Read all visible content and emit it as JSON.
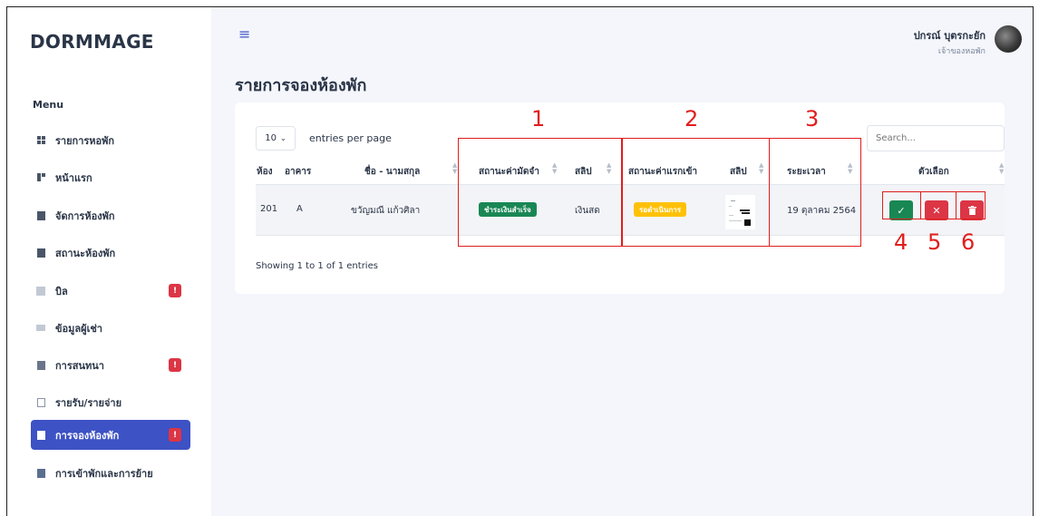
{
  "brand": "DORMMAGE",
  "sidebar": {
    "menu_title": "Menu",
    "items": [
      {
        "label": "รายการหอพัก",
        "icon": "grid-icon"
      },
      {
        "label": "หน้าแรก",
        "icon": "layout-icon"
      },
      {
        "label": "จัดการห้องพัก",
        "icon": "building-icon"
      },
      {
        "label": "สถานะห้องพัก",
        "icon": "door-icon"
      },
      {
        "label": "บิล",
        "icon": "receipt-icon",
        "badge": "!"
      },
      {
        "label": "ข้อมูลผู้เช่า",
        "icon": "users-icon"
      },
      {
        "label": "การสนทนา",
        "icon": "chat-icon",
        "badge": "!"
      },
      {
        "label": "รายรับ/รายจ่าย",
        "icon": "document-icon"
      },
      {
        "label": "การจองห้องพัก",
        "icon": "bookmark-icon",
        "badge": "!",
        "active": true
      },
      {
        "label": "การเข้าพักและการย้าย",
        "icon": "move-icon"
      }
    ]
  },
  "header": {
    "menu_icon": "hamburger-icon",
    "user_name": "ปกรณ์ บุตรกะยัก",
    "user_role": "เจ้าของหอพัก"
  },
  "page": {
    "title": "รายการจองห้องพัก",
    "entries_value": "10",
    "entries_label": "entries per page",
    "search_placeholder": "Search...",
    "showing": "Showing 1 to 1 of 1 entries"
  },
  "table": {
    "columns": [
      "ห้อง",
      "อาคาร",
      "ชื่อ - นามสกุล",
      "สถานะค่ามัดจำ",
      "สลิป",
      "สถานะค่าแรกเข้า",
      "สลิป",
      "ระยะเวลา",
      "ตัวเลือก"
    ],
    "rows": [
      {
        "room": "201",
        "building": "A",
        "name": "ขวัญมณี แก้วศิลา",
        "deposit_status": "ชำระเงินสำเร็จ",
        "deposit_slip": "เงินสด",
        "entry_status": "รอดำเนินการ",
        "duration": "19 ตุลาคม 2564"
      }
    ]
  },
  "annotations": [
    "1",
    "2",
    "3",
    "4",
    "5",
    "6"
  ],
  "colors": {
    "accent": "#3d52c4",
    "success": "#198754",
    "warning": "#ffc107",
    "danger": "#dc3545",
    "annotation": "#e11d1d"
  }
}
